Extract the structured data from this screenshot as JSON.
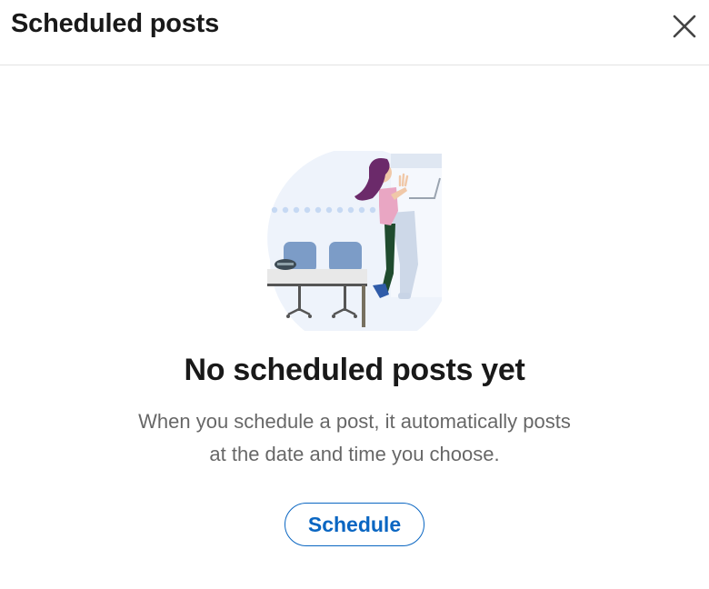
{
  "header": {
    "title": "Scheduled posts",
    "close_icon": "close-icon"
  },
  "empty_state": {
    "illustration": "person-at-desk-illustration",
    "title": "No scheduled posts yet",
    "description": "When you schedule a post, it automatically posts at the date and time you choose.",
    "button_label": "Schedule"
  },
  "colors": {
    "accent": "#0a66c2",
    "title_text": "#1a1a1a",
    "body_text": "#666666",
    "divider": "#e3e3e3"
  }
}
